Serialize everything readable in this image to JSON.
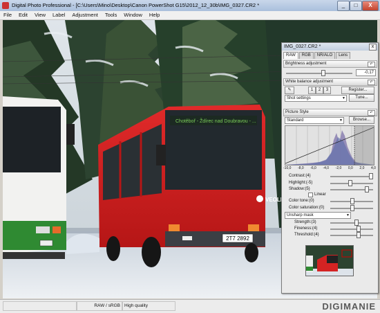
{
  "window": {
    "title": "Digital Photo Professional - [C:\\Users\\Mino\\Desktop\\Canon PowerShot G15\\2012_12_30b\\IMG_0327.CR2 *",
    "min_label": "_",
    "max_label": "□",
    "close_label": "X"
  },
  "menu": [
    "File",
    "Edit",
    "View",
    "Label",
    "Adjustment",
    "Tools",
    "Window",
    "Help"
  ],
  "photo": {
    "bus_plate": "2T7 2892",
    "bus_brand": "VEOLIA",
    "bus_sign": "Chotěboř - Ždírec nad Doubravou - ..."
  },
  "status": {
    "format": "RAW / sRGB",
    "quality": "High quality",
    "watermark": "DIGIMANIE"
  },
  "panel": {
    "title": "IMG_0327.CR2 *",
    "close_label": "x",
    "tabs": [
      "RAW",
      "RGB",
      "NR/ALO",
      "Lens"
    ],
    "brightness": {
      "title": "Brightness adjustment",
      "value": "-0,17",
      "undo": "↶"
    },
    "white_balance": {
      "title": "White balance adjustment",
      "undo": "↶",
      "eyedropper": "✎",
      "slots": [
        "1",
        "2",
        "3"
      ],
      "register_label": "Register...",
      "preset": "Shot settings",
      "tune_label": "Tune..."
    },
    "picture_style": {
      "title": "Picture Style",
      "undo": "↶",
      "value": "Standard",
      "browse_label": "Browse..."
    },
    "hist_axis": [
      "-10,0",
      "-8,0",
      "-6,0",
      "-4,0",
      "-2,0",
      "0,0",
      "2,0",
      "4,0"
    ],
    "params": {
      "contrast": "Contrast:(4)",
      "highlight": "Highlight:(-5)",
      "shadow": "Shadow:(5)",
      "linear": "Linear",
      "color_tone": "Color tone:(0)",
      "color_saturation": "Color saturation:(0)",
      "sharpen_mode": "Unsharp mask",
      "strength": "Strength:(3)",
      "fineness": "Fineness:(4)",
      "threshold": "Threshold:(4)"
    }
  }
}
